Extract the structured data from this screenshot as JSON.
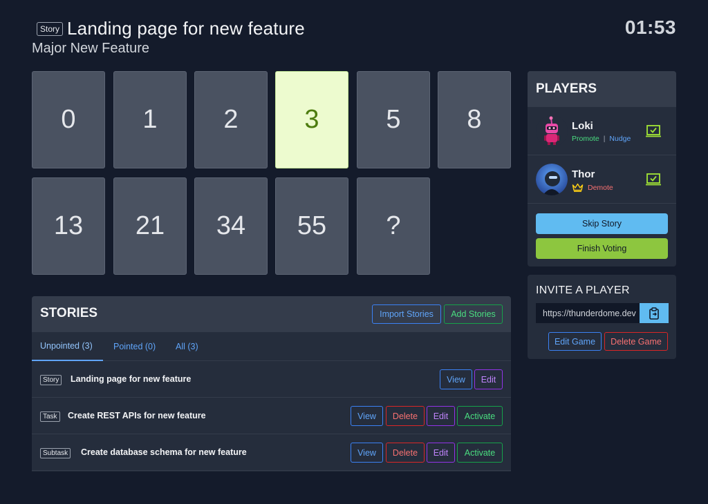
{
  "header": {
    "story_type": "Story",
    "story_title": "Landing page for new feature",
    "epic": "Major New Feature",
    "timer": "01:53"
  },
  "cards": [
    "0",
    "1",
    "2",
    "3",
    "5",
    "8",
    "13",
    "21",
    "34",
    "55",
    "?"
  ],
  "selected_card": "3",
  "players": {
    "title": "PLAYERS",
    "list": [
      {
        "name": "Loki",
        "promote": "Promote",
        "separator": "|",
        "nudge": "Nudge",
        "voted": true
      },
      {
        "name": "Thor",
        "demote": "Demote",
        "is_leader": true,
        "voted": true
      }
    ],
    "skip_label": "Skip Story",
    "finish_label": "Finish Voting"
  },
  "invite": {
    "title": "INVITE A PLAYER",
    "link": "https://thunderdome.dev",
    "edit_label": "Edit Game",
    "delete_label": "Delete Game"
  },
  "stories": {
    "title": "STORIES",
    "import_label": "Import Stories",
    "add_label": "Add Stories",
    "tabs": [
      {
        "label": "Unpointed (3)",
        "active": true
      },
      {
        "label": "Pointed (0)",
        "active": false
      },
      {
        "label": "All (3)",
        "active": false
      }
    ],
    "rows": [
      {
        "type": "Story",
        "name": "Landing page for new feature",
        "view": "View",
        "edit": "Edit"
      },
      {
        "type": "Task",
        "name": "Create REST APIs for new feature",
        "view": "View",
        "delete": "Delete",
        "edit": "Edit",
        "activate": "Activate"
      },
      {
        "type": "Subtask",
        "name": "Create database schema for new feature",
        "view": "View",
        "delete": "Delete",
        "edit": "Edit",
        "activate": "Activate"
      }
    ]
  },
  "colors": {
    "background": "#141b2b",
    "panel": "#252d3c",
    "selected_card": "#edfbcf",
    "skip": "#60bbf1",
    "finish": "#8dc63f"
  }
}
